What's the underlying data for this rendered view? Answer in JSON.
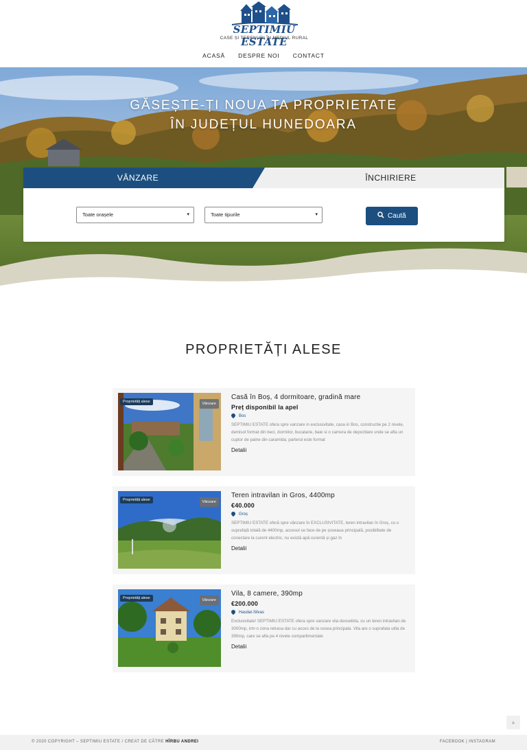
{
  "logo": {
    "name": "SEPTIMIU ESTATE",
    "tagline": "CASE ȘI TERENURI ÎN MEDIUL RURAL"
  },
  "nav": [
    "ACASĂ",
    "DESPRE NOI",
    "CONTACT"
  ],
  "hero": {
    "line1": "GĂSEȘTE-ȚI NOUA TA PROPRIETATE",
    "line2": "ÎN JUDEȚUL HUNEDOARA"
  },
  "search": {
    "tab_sale": "VÂNZARE",
    "tab_rent": "ÎNCHIRIERE",
    "city_select": "Toate orașele",
    "type_select": "Toate tipurile",
    "button": "Caută"
  },
  "section_title": "PROPRIETĂȚI ALESE",
  "listings": [
    {
      "badge_featured": "Proprietăți alese",
      "badge_status": "Vânzare",
      "title": "Casă în Boș, 4 dormitoare, gradină mare",
      "price": "Preț disponibil la apel",
      "location": "Bos",
      "description": "SEPTIMIU ESTATE ofera spre vanzare in exclusivitate, casa in Bos, constructie pe 2 nivele, demisol format din beci, dormitor, bucatarie, baie si o camera de depozitare unde se afla un cuptor de paine din caramida; parterul este format",
      "link": "Detalii"
    },
    {
      "badge_featured": "Proprietăți alese",
      "badge_status": "Vânzare",
      "title": "Teren intravilan in Gros, 4400mp",
      "price": "€40.000",
      "location": "Groș",
      "description": "SEPTIMIU ESTATE oferă spre vânzare în EXCLUSIVITATE, teren intravilan în Groș, cu o suprafață totală de 4400mp, accesul se face de pe șoseaua principală, posibilitate de conectare la curent electric, nu există apă curentă și gaz în",
      "link": "Detalii"
    },
    {
      "badge_featured": "Proprietăți alese",
      "badge_status": "Vânzare",
      "title": "Vila, 8 camere, 390mp",
      "price": "€200.000",
      "location": "Hasdat-Silvas",
      "description": "Exclusivitate! SEPTIMIU ESTATE ofera spre vanzare vila deosebita, cu un teren intravilan de 3000mp, intr-o zona retrasa dar cu acces de la sosea principala. Vila are o suprafata utila de 390mp, care se afla pe 4 nivele compartimentate",
      "link": "Detalii"
    }
  ],
  "footer": {
    "copyright": "© 2020 COPYRIGHT – SEPTIMIU ESTATE / CREAT DE CĂTRE",
    "author": "HÎRBU ANDREI",
    "social": "FACEBOOK | INSTAGRAM"
  }
}
